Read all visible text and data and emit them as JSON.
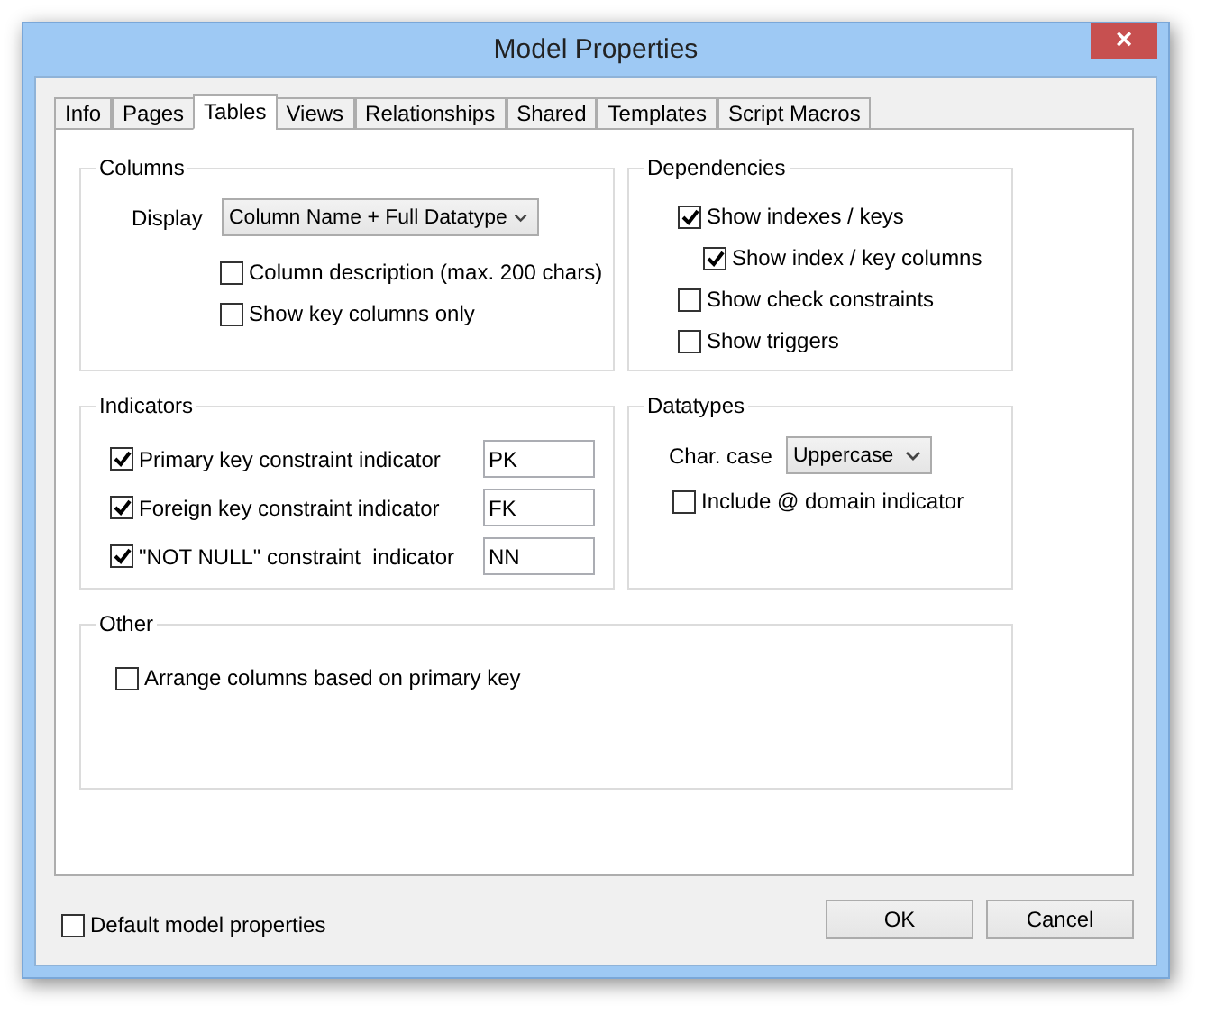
{
  "window": {
    "title": "Model Properties",
    "close": "×"
  },
  "tabs": [
    {
      "label": "Info",
      "selected": false
    },
    {
      "label": "Pages",
      "selected": false
    },
    {
      "label": "Tables",
      "selected": true
    },
    {
      "label": "Views",
      "selected": false
    },
    {
      "label": "Relationships",
      "selected": false
    },
    {
      "label": "Shared",
      "selected": false
    },
    {
      "label": "Templates",
      "selected": false
    },
    {
      "label": "Script Macros",
      "selected": false
    }
  ],
  "columns": {
    "title": "Columns",
    "display_label": "Display",
    "display_value": "Column Name + Full Datatype",
    "checkboxes": [
      {
        "label": "Column description (max. 200 chars)",
        "checked": false
      },
      {
        "label": "Show key columns only",
        "checked": false
      }
    ]
  },
  "dependencies": {
    "title": "Dependencies",
    "checkboxes": [
      {
        "label": "Show indexes / keys",
        "checked": true,
        "children": [
          {
            "label": "Show index / key columns",
            "checked": true
          }
        ]
      },
      {
        "label": "Show check constraints",
        "checked": false
      },
      {
        "label": "Show triggers",
        "checked": false
      }
    ]
  },
  "indicators": {
    "title": "Indicators",
    "rows": [
      {
        "label": "Primary key constraint indicator",
        "checked": true,
        "value": "PK"
      },
      {
        "label": "Foreign key constraint indicator",
        "checked": true,
        "value": "FK"
      },
      {
        "label": "\"NOT NULL\" constraint  indicator",
        "checked": true,
        "value": "NN"
      }
    ]
  },
  "datatypes": {
    "title": "Datatypes",
    "char_case_label": "Char. case",
    "char_case_value": "Uppercase",
    "checkboxes": [
      {
        "label": "Include @ domain indicator",
        "checked": false
      }
    ]
  },
  "other": {
    "title": "Other",
    "checkboxes": [
      {
        "label": "Arrange columns based on primary key",
        "checked": false
      }
    ]
  },
  "footer": {
    "checkbox": {
      "label": "Default model properties",
      "checked": false
    },
    "buttons": [
      "OK",
      "Cancel"
    ]
  }
}
